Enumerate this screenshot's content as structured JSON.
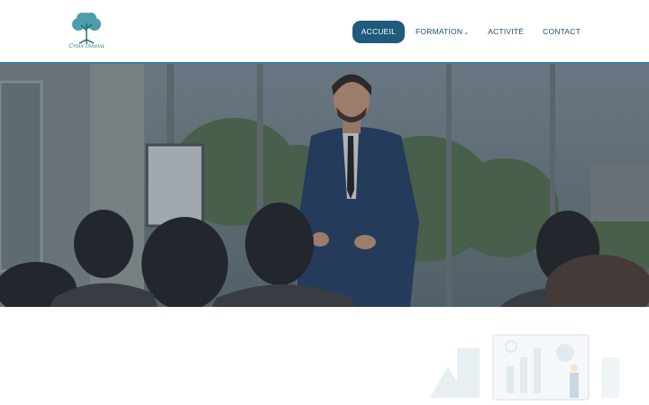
{
  "brand": {
    "logo_text": "Croix Innova"
  },
  "nav": {
    "items": [
      {
        "label": "ACCUEIL",
        "active": true
      },
      {
        "label": "FORMATION",
        "has_dropdown": true
      },
      {
        "label": "ACTIVITÉ"
      },
      {
        "label": "CONTACT"
      }
    ]
  },
  "hero": {
    "image": "presenter-speaking-to-audience-photo"
  },
  "lower": {
    "illustration": "presentation-illustration"
  },
  "colors": {
    "accent": "#1f5b7d",
    "hero_border": "#2f7fa6",
    "nav_text": "#1b4f6d",
    "logo": "#2c7f8c"
  }
}
